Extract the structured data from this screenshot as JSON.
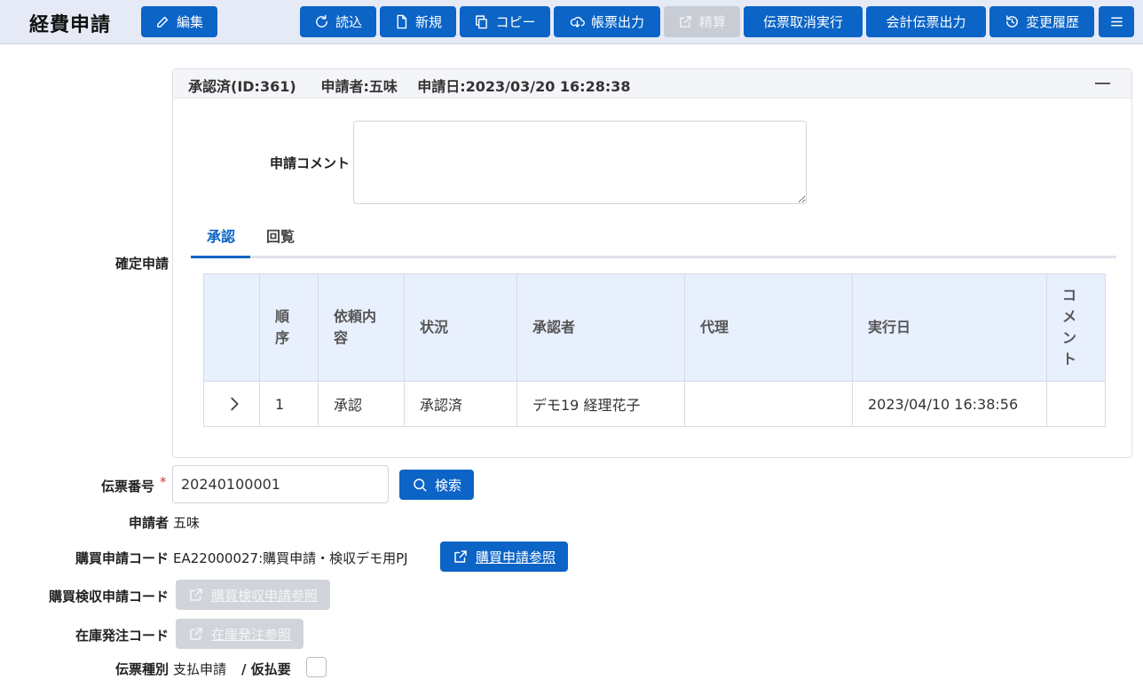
{
  "app": {
    "title": "経費申請"
  },
  "toolbar": {
    "edit": "編集",
    "load": "読込",
    "new": "新規",
    "copy": "コピー",
    "export": "帳票出力",
    "settle": "精算",
    "cancel": "伝票取消実行",
    "accounting": "会計伝票出力",
    "history": "変更履歴"
  },
  "approval": {
    "confirm_label": "確定申請",
    "header": "承認済(ID:361)     申請者:五味    申請日:2023/03/20 16:28:38",
    "comment_label": "申請コメント",
    "comment_value": "",
    "tabs": [
      "承認",
      "回覧"
    ],
    "columns": [
      "",
      "順序",
      "依頼内容",
      "状況",
      "承認者",
      "代理",
      "実行日",
      "コメント"
    ],
    "rows": [
      {
        "order": "1",
        "request": "承認",
        "status": "承認済",
        "approver": "デモ19 経理花子",
        "proxy": "",
        "date": "2023/04/10 16:38:56",
        "comment": ""
      }
    ]
  },
  "form": {
    "slip_no_label": "伝票番号",
    "slip_no_value": "20240100001",
    "search": "検索",
    "applicant_label": "申請者",
    "applicant_value": "五味",
    "purchase_code_label": "購買申請コード",
    "purchase_code_value": "EA22000027:購買申請・検収デモ用PJ",
    "purchase_ref": "購買申請参照",
    "inspect_code_label": "購買検収申請コード",
    "inspect_ref": "購買検収申請参照",
    "stock_code_label": "在庫発注コード",
    "stock_ref": "在庫発注参照",
    "slip_type_label": "伝票種別",
    "slip_type_value": "支払申請",
    "advance_label": "/ 仮払要"
  }
}
